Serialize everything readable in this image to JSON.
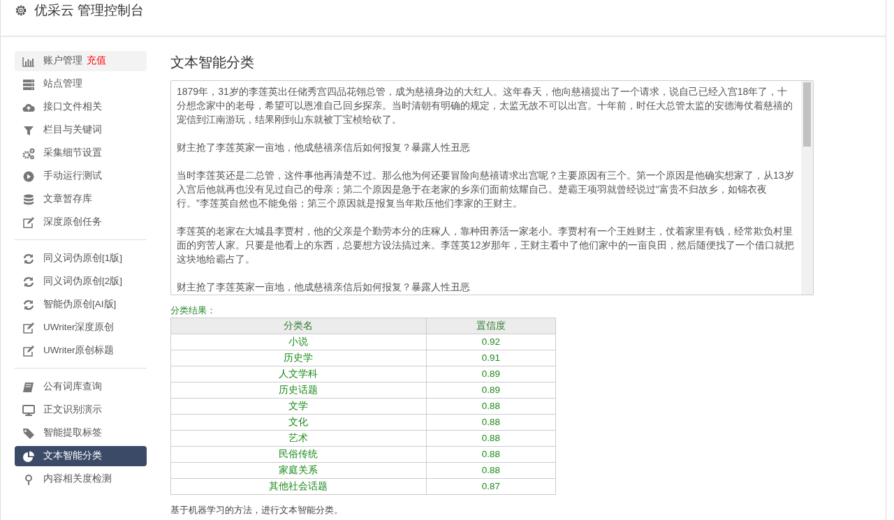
{
  "header": {
    "title": "优采云 管理控制台"
  },
  "sidebar": {
    "groups": [
      {
        "items": [
          {
            "label": "账户管理",
            "badge": "充值",
            "kind": "bars",
            "selected": false,
            "hover": true
          },
          {
            "label": "站点管理",
            "kind": "server",
            "selected": false,
            "hover": false
          },
          {
            "label": "接口文件相关",
            "kind": "cloud",
            "selected": false,
            "hover": false
          },
          {
            "label": "栏目与关键词",
            "kind": "filter",
            "selected": false,
            "hover": false
          },
          {
            "label": "采集细节设置",
            "kind": "gears",
            "selected": false,
            "hover": false
          },
          {
            "label": "手动运行测试",
            "kind": "play",
            "selected": false,
            "hover": false
          },
          {
            "label": "文章暂存库",
            "kind": "database",
            "selected": false,
            "hover": false
          },
          {
            "label": "深度原创任务",
            "kind": "edit",
            "selected": false,
            "hover": false
          }
        ]
      },
      {
        "items": [
          {
            "label": "同义词伪原创[1版]",
            "kind": "refresh",
            "selected": false,
            "hover": false
          },
          {
            "label": "同义词伪原创[2版]",
            "kind": "refresh",
            "selected": false,
            "hover": false
          },
          {
            "label": "智能伪原创[AI版]",
            "kind": "refresh",
            "selected": false,
            "hover": false
          },
          {
            "label": "UWriter深度原创",
            "kind": "edit",
            "selected": false,
            "hover": false
          },
          {
            "label": "UWriter原创标题",
            "kind": "edit",
            "selected": false,
            "hover": false
          }
        ]
      },
      {
        "items": [
          {
            "label": "公有词库查询",
            "kind": "book",
            "selected": false,
            "hover": false
          },
          {
            "label": "正文识别演示",
            "kind": "monitor",
            "selected": false,
            "hover": false
          },
          {
            "label": "智能提取标签",
            "kind": "tag",
            "selected": false,
            "hover": false
          },
          {
            "label": "文本智能分类",
            "kind": "pie",
            "selected": true,
            "hover": false
          },
          {
            "label": "内容相关度检测",
            "kind": "pin",
            "selected": false,
            "hover": false
          }
        ]
      }
    ]
  },
  "main": {
    "heading": "文本智能分类",
    "article": [
      "1879年，31岁的李莲英出任储秀宫四品花翎总管，成为慈禧身边的大红人。这年春天，他向慈禧提出了一个请求，说自己已经入宫18年了，十分想念家中的老母，希望可以恩准自己回乡探亲。当时清朝有明确的规定，太监无故不可以出宫。十年前，时任大总管太监的安德海仗着慈禧的宠信到江南游玩，结果刚到山东就被丁宝桢给砍了。",
      "财主抢了李莲英家一亩地，他成慈禧亲信后如何报复？暴露人性丑恶",
      "当时李莲英还是二总管，这件事他再清楚不过。那么他为何还要冒险向慈禧请求出宫呢？主要原因有三个。第一个原因是他确实想家了，从13岁入宫后他就再也没有见过自己的母亲；第二个原因是急于在老家的乡亲们面前炫耀自己。楚霸王项羽就曾经说过“富贵不归故乡，如锦衣夜行。”李莲英自然也不能免俗；第三个原因就是报复当年欺压他们李家的王财主。",
      "李莲英的老家在大城县李贾村，他的父亲是个勤劳本分的庄稼人，靠种田养活一家老小。李贾村有一个王姓财主，仗着家里有钱，经常欺负村里面的穷苦人家。只要是他看上的东西，总要想方设法搞过来。李莲英12岁那年，王财主看中了他们家中的一亩良田，然后随便找了一个借口就把这块地给霸占了。",
      "财主抢了李莲英家一亩地，他成慈禧亲信后如何报复？暴露人性丑恶"
    ],
    "result_label": "分类结果：",
    "table": {
      "columns": [
        "分类名",
        "置信度"
      ],
      "rows": [
        [
          "小说",
          "0.92"
        ],
        [
          "历史学",
          "0.91"
        ],
        [
          "人文学科",
          "0.89"
        ],
        [
          "历史话题",
          "0.89"
        ],
        [
          "文学",
          "0.88"
        ],
        [
          "文化",
          "0.88"
        ],
        [
          "艺术",
          "0.88"
        ],
        [
          "民俗传统",
          "0.88"
        ],
        [
          "家庭关系",
          "0.88"
        ],
        [
          "其他社会话题",
          "0.87"
        ]
      ]
    },
    "footnote": "基于机器学习的方法，进行文本智能分类。"
  }
}
